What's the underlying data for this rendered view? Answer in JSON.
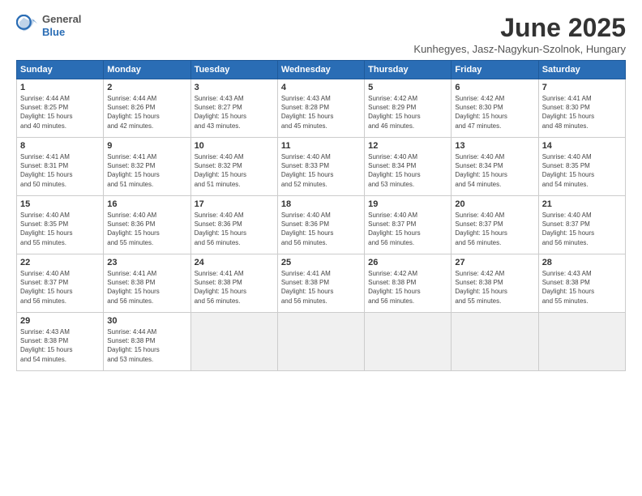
{
  "logo": {
    "general": "General",
    "blue": "Blue"
  },
  "title": "June 2025",
  "location": "Kunhegyes, Jasz-Nagykun-Szolnok, Hungary",
  "weekdays": [
    "Sunday",
    "Monday",
    "Tuesday",
    "Wednesday",
    "Thursday",
    "Friday",
    "Saturday"
  ],
  "weeks": [
    [
      {
        "day": 1,
        "info": "Sunrise: 4:44 AM\nSunset: 8:25 PM\nDaylight: 15 hours\nand 40 minutes."
      },
      {
        "day": 2,
        "info": "Sunrise: 4:44 AM\nSunset: 8:26 PM\nDaylight: 15 hours\nand 42 minutes."
      },
      {
        "day": 3,
        "info": "Sunrise: 4:43 AM\nSunset: 8:27 PM\nDaylight: 15 hours\nand 43 minutes."
      },
      {
        "day": 4,
        "info": "Sunrise: 4:43 AM\nSunset: 8:28 PM\nDaylight: 15 hours\nand 45 minutes."
      },
      {
        "day": 5,
        "info": "Sunrise: 4:42 AM\nSunset: 8:29 PM\nDaylight: 15 hours\nand 46 minutes."
      },
      {
        "day": 6,
        "info": "Sunrise: 4:42 AM\nSunset: 8:30 PM\nDaylight: 15 hours\nand 47 minutes."
      },
      {
        "day": 7,
        "info": "Sunrise: 4:41 AM\nSunset: 8:30 PM\nDaylight: 15 hours\nand 48 minutes."
      }
    ],
    [
      {
        "day": 8,
        "info": "Sunrise: 4:41 AM\nSunset: 8:31 PM\nDaylight: 15 hours\nand 50 minutes."
      },
      {
        "day": 9,
        "info": "Sunrise: 4:41 AM\nSunset: 8:32 PM\nDaylight: 15 hours\nand 51 minutes."
      },
      {
        "day": 10,
        "info": "Sunrise: 4:40 AM\nSunset: 8:32 PM\nDaylight: 15 hours\nand 51 minutes."
      },
      {
        "day": 11,
        "info": "Sunrise: 4:40 AM\nSunset: 8:33 PM\nDaylight: 15 hours\nand 52 minutes."
      },
      {
        "day": 12,
        "info": "Sunrise: 4:40 AM\nSunset: 8:34 PM\nDaylight: 15 hours\nand 53 minutes."
      },
      {
        "day": 13,
        "info": "Sunrise: 4:40 AM\nSunset: 8:34 PM\nDaylight: 15 hours\nand 54 minutes."
      },
      {
        "day": 14,
        "info": "Sunrise: 4:40 AM\nSunset: 8:35 PM\nDaylight: 15 hours\nand 54 minutes."
      }
    ],
    [
      {
        "day": 15,
        "info": "Sunrise: 4:40 AM\nSunset: 8:35 PM\nDaylight: 15 hours\nand 55 minutes."
      },
      {
        "day": 16,
        "info": "Sunrise: 4:40 AM\nSunset: 8:36 PM\nDaylight: 15 hours\nand 55 minutes."
      },
      {
        "day": 17,
        "info": "Sunrise: 4:40 AM\nSunset: 8:36 PM\nDaylight: 15 hours\nand 56 minutes."
      },
      {
        "day": 18,
        "info": "Sunrise: 4:40 AM\nSunset: 8:36 PM\nDaylight: 15 hours\nand 56 minutes."
      },
      {
        "day": 19,
        "info": "Sunrise: 4:40 AM\nSunset: 8:37 PM\nDaylight: 15 hours\nand 56 minutes."
      },
      {
        "day": 20,
        "info": "Sunrise: 4:40 AM\nSunset: 8:37 PM\nDaylight: 15 hours\nand 56 minutes."
      },
      {
        "day": 21,
        "info": "Sunrise: 4:40 AM\nSunset: 8:37 PM\nDaylight: 15 hours\nand 56 minutes."
      }
    ],
    [
      {
        "day": 22,
        "info": "Sunrise: 4:40 AM\nSunset: 8:37 PM\nDaylight: 15 hours\nand 56 minutes."
      },
      {
        "day": 23,
        "info": "Sunrise: 4:41 AM\nSunset: 8:38 PM\nDaylight: 15 hours\nand 56 minutes."
      },
      {
        "day": 24,
        "info": "Sunrise: 4:41 AM\nSunset: 8:38 PM\nDaylight: 15 hours\nand 56 minutes."
      },
      {
        "day": 25,
        "info": "Sunrise: 4:41 AM\nSunset: 8:38 PM\nDaylight: 15 hours\nand 56 minutes."
      },
      {
        "day": 26,
        "info": "Sunrise: 4:42 AM\nSunset: 8:38 PM\nDaylight: 15 hours\nand 56 minutes."
      },
      {
        "day": 27,
        "info": "Sunrise: 4:42 AM\nSunset: 8:38 PM\nDaylight: 15 hours\nand 55 minutes."
      },
      {
        "day": 28,
        "info": "Sunrise: 4:43 AM\nSunset: 8:38 PM\nDaylight: 15 hours\nand 55 minutes."
      }
    ],
    [
      {
        "day": 29,
        "info": "Sunrise: 4:43 AM\nSunset: 8:38 PM\nDaylight: 15 hours\nand 54 minutes."
      },
      {
        "day": 30,
        "info": "Sunrise: 4:44 AM\nSunset: 8:38 PM\nDaylight: 15 hours\nand 53 minutes."
      },
      null,
      null,
      null,
      null,
      null
    ]
  ]
}
